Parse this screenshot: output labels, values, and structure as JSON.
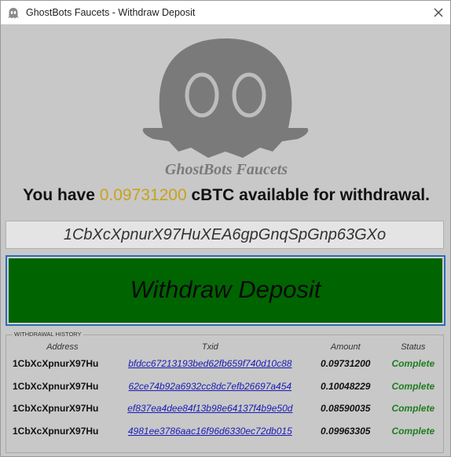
{
  "window": {
    "title": "GhostBots Faucets - Withdraw Deposit",
    "close_icon": "close-icon",
    "app_icon": "ghost-app-icon"
  },
  "branding": {
    "logo_icon": "ghost-logo-icon",
    "name": "GhostBots Faucets"
  },
  "balance": {
    "prefix": "You have ",
    "amount": "0.09731200",
    "suffix": " cBTC available for withdrawal.",
    "amount_color": "#c9a21a"
  },
  "withdraw_address": "1CbXcXpnurX97HuXEA6gpGnqSpGnp63GXo",
  "withdraw_button": {
    "label": "Withdraw Deposit",
    "color": "#006400"
  },
  "history": {
    "title": "WITHDRAWAL HISTORY",
    "columns": [
      "Address",
      "Txid",
      "Amount",
      "Status"
    ],
    "rows": [
      {
        "address": "1CbXcXpnurX97Hu",
        "txid": "bfdcc67213193bed62fb659f740d10c88",
        "amount": "0.09731200",
        "status": "Complete"
      },
      {
        "address": "1CbXcXpnurX97Hu",
        "txid": "62ce74b92a6932cc8dc7efb26697a454",
        "amount": "0.10048229",
        "status": "Complete"
      },
      {
        "address": "1CbXcXpnurX97Hu",
        "txid": "ef837ea4dee84f13b98e64137f4b9e50d",
        "amount": "0.08590035",
        "status": "Complete"
      },
      {
        "address": "1CbXcXpnurX97Hu",
        "txid": "4981ee3786aac16f96d6330ec72db015",
        "amount": "0.09963305",
        "status": "Complete"
      }
    ],
    "status_color": "#1f7d1f",
    "link_color": "#1a1ab8"
  }
}
